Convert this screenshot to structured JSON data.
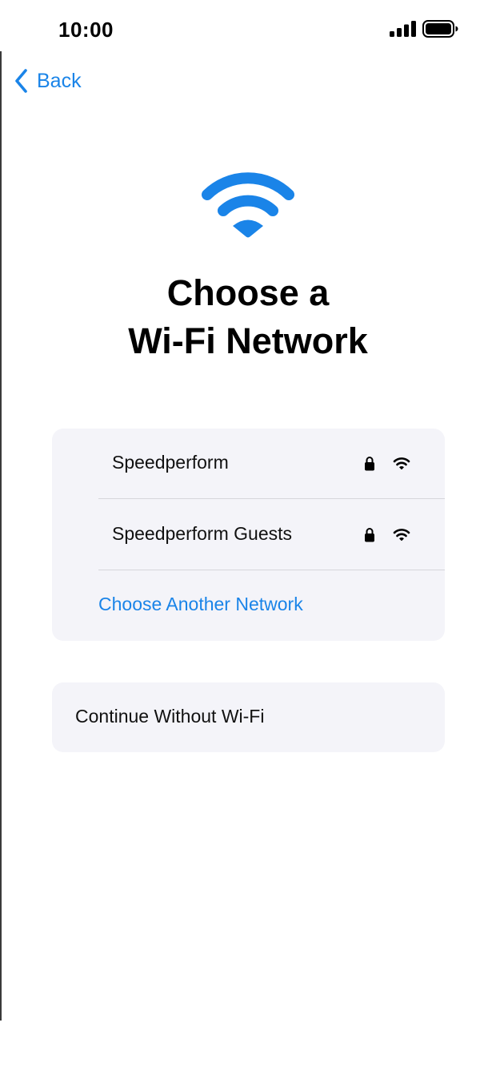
{
  "status_bar": {
    "time": "10:00",
    "signal_icon": "cellular-signal-icon",
    "battery_icon": "battery-icon"
  },
  "nav": {
    "back_label": "Back",
    "back_icon": "chevron-left-icon"
  },
  "header": {
    "icon": "wifi-icon",
    "title_line1": "Choose a",
    "title_line2": "Wi-Fi Network"
  },
  "networks": [
    {
      "name": "Speedperform",
      "secured": true,
      "lock_icon": "lock-icon",
      "signal_icon": "wifi-signal-icon"
    },
    {
      "name": "Speedperform Guests",
      "secured": true,
      "lock_icon": "lock-icon",
      "signal_icon": "wifi-signal-icon"
    }
  ],
  "other_network_label": "Choose Another Network",
  "continue_label": "Continue Without Wi-Fi",
  "colors": {
    "accent": "#1a84e8",
    "card_background": "#f4f4f9",
    "divider": "#d6d6db",
    "text": "#111111"
  }
}
